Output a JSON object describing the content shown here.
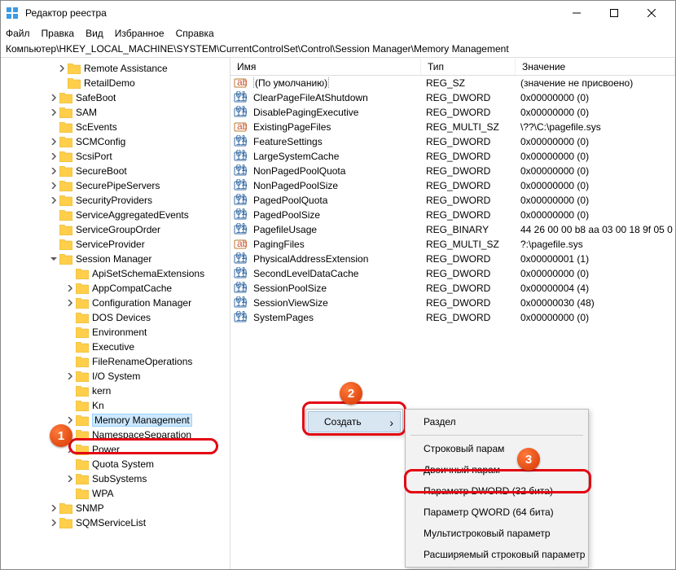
{
  "window": {
    "title": "Редактор реестра"
  },
  "menu": {
    "file": "Файл",
    "edit": "Правка",
    "view": "Вид",
    "favorites": "Избранное",
    "help": "Справка"
  },
  "path": "Компьютер\\HKEY_LOCAL_MACHINE\\SYSTEM\\CurrentControlSet\\Control\\Session Manager\\Memory Management",
  "tree": [
    {
      "ind": 68,
      "chev": "r",
      "txt": "Remote Assistance"
    },
    {
      "ind": 68,
      "chev": "",
      "txt": "RetailDemo"
    },
    {
      "ind": 58,
      "chev": "r",
      "txt": "SafeBoot"
    },
    {
      "ind": 58,
      "chev": "r",
      "txt": "SAM"
    },
    {
      "ind": 58,
      "chev": "",
      "txt": "ScEvents"
    },
    {
      "ind": 58,
      "chev": "r",
      "txt": "SCMConfig"
    },
    {
      "ind": 58,
      "chev": "r",
      "txt": "ScsiPort"
    },
    {
      "ind": 58,
      "chev": "r",
      "txt": "SecureBoot"
    },
    {
      "ind": 58,
      "chev": "r",
      "txt": "SecurePipeServers"
    },
    {
      "ind": 58,
      "chev": "r",
      "txt": "SecurityProviders"
    },
    {
      "ind": 58,
      "chev": "",
      "txt": "ServiceAggregatedEvents"
    },
    {
      "ind": 58,
      "chev": "",
      "txt": "ServiceGroupOrder"
    },
    {
      "ind": 58,
      "chev": "",
      "txt": "ServiceProvider"
    },
    {
      "ind": 58,
      "chev": "d",
      "txt": "Session Manager"
    },
    {
      "ind": 78,
      "chev": "",
      "txt": "ApiSetSchemaExtensions"
    },
    {
      "ind": 78,
      "chev": "r",
      "txt": "AppCompatCache"
    },
    {
      "ind": 78,
      "chev": "r",
      "txt": "Configuration Manager"
    },
    {
      "ind": 78,
      "chev": "",
      "txt": "DOS Devices"
    },
    {
      "ind": 78,
      "chev": "",
      "txt": "Environment"
    },
    {
      "ind": 78,
      "chev": "",
      "txt": "Executive"
    },
    {
      "ind": 78,
      "chev": "",
      "txt": "FileRenameOperations"
    },
    {
      "ind": 78,
      "chev": "r",
      "txt": "I/O System"
    },
    {
      "ind": 78,
      "chev": "",
      "txt": "kern"
    },
    {
      "ind": 78,
      "chev": "",
      "txt": "Kn"
    },
    {
      "ind": 78,
      "chev": "r",
      "txt": "Memory Management",
      "sel": true,
      "hl": true
    },
    {
      "ind": 78,
      "chev": "",
      "txt": "NamespaceSeparation"
    },
    {
      "ind": 78,
      "chev": "r",
      "txt": "Power"
    },
    {
      "ind": 78,
      "chev": "",
      "txt": "Quota System"
    },
    {
      "ind": 78,
      "chev": "r",
      "txt": "SubSystems"
    },
    {
      "ind": 78,
      "chev": "",
      "txt": "WPA"
    },
    {
      "ind": 58,
      "chev": "r",
      "txt": "SNMP"
    },
    {
      "ind": 58,
      "chev": "r",
      "txt": "SQMServiceList"
    }
  ],
  "list": {
    "headers": {
      "name": "Имя",
      "type": "Тип",
      "value": "Значение"
    },
    "rows": [
      {
        "icon": "sz",
        "name": "(По умолчанию)",
        "type": "REG_SZ",
        "val": "(значение не присвоено)",
        "sel": true
      },
      {
        "icon": "dw",
        "name": "ClearPageFileAtShutdown",
        "type": "REG_DWORD",
        "val": "0x00000000 (0)"
      },
      {
        "icon": "dw",
        "name": "DisablePagingExecutive",
        "type": "REG_DWORD",
        "val": "0x00000000 (0)"
      },
      {
        "icon": "sz",
        "name": "ExistingPageFiles",
        "type": "REG_MULTI_SZ",
        "val": "\\??\\C:\\pagefile.sys"
      },
      {
        "icon": "dw",
        "name": "FeatureSettings",
        "type": "REG_DWORD",
        "val": "0x00000000 (0)"
      },
      {
        "icon": "dw",
        "name": "LargeSystemCache",
        "type": "REG_DWORD",
        "val": "0x00000000 (0)"
      },
      {
        "icon": "dw",
        "name": "NonPagedPoolQuota",
        "type": "REG_DWORD",
        "val": "0x00000000 (0)"
      },
      {
        "icon": "dw",
        "name": "NonPagedPoolSize",
        "type": "REG_DWORD",
        "val": "0x00000000 (0)"
      },
      {
        "icon": "dw",
        "name": "PagedPoolQuota",
        "type": "REG_DWORD",
        "val": "0x00000000 (0)"
      },
      {
        "icon": "dw",
        "name": "PagedPoolSize",
        "type": "REG_DWORD",
        "val": "0x00000000 (0)"
      },
      {
        "icon": "dw",
        "name": "PagefileUsage",
        "type": "REG_BINARY",
        "val": "44 26 00 00 b8 aa 03 00 18 9f 05 0"
      },
      {
        "icon": "sz",
        "name": "PagingFiles",
        "type": "REG_MULTI_SZ",
        "val": "?:\\pagefile.sys"
      },
      {
        "icon": "dw",
        "name": "PhysicalAddressExtension",
        "type": "REG_DWORD",
        "val": "0x00000001 (1)"
      },
      {
        "icon": "dw",
        "name": "SecondLevelDataCache",
        "type": "REG_DWORD",
        "val": "0x00000000 (0)"
      },
      {
        "icon": "dw",
        "name": "SessionPoolSize",
        "type": "REG_DWORD",
        "val": "0x00000004 (4)"
      },
      {
        "icon": "dw",
        "name": "SessionViewSize",
        "type": "REG_DWORD",
        "val": "0x00000030 (48)"
      },
      {
        "icon": "dw",
        "name": "SystemPages",
        "type": "REG_DWORD",
        "val": "0x00000000 (0)"
      }
    ]
  },
  "ctx_main": {
    "create": "Создать"
  },
  "ctx_sub": {
    "key": "Раздел",
    "string": "Строковый парам",
    "binary": "Двоичный парам",
    "dword": "Параметр DWORD (32 бита)",
    "qword": "Параметр QWORD (64 бита)",
    "multi": "Мультистроковый параметр",
    "expand": "Расширяемый строковый параметр"
  },
  "badges": {
    "b1": "1",
    "b2": "2",
    "b3": "3"
  }
}
